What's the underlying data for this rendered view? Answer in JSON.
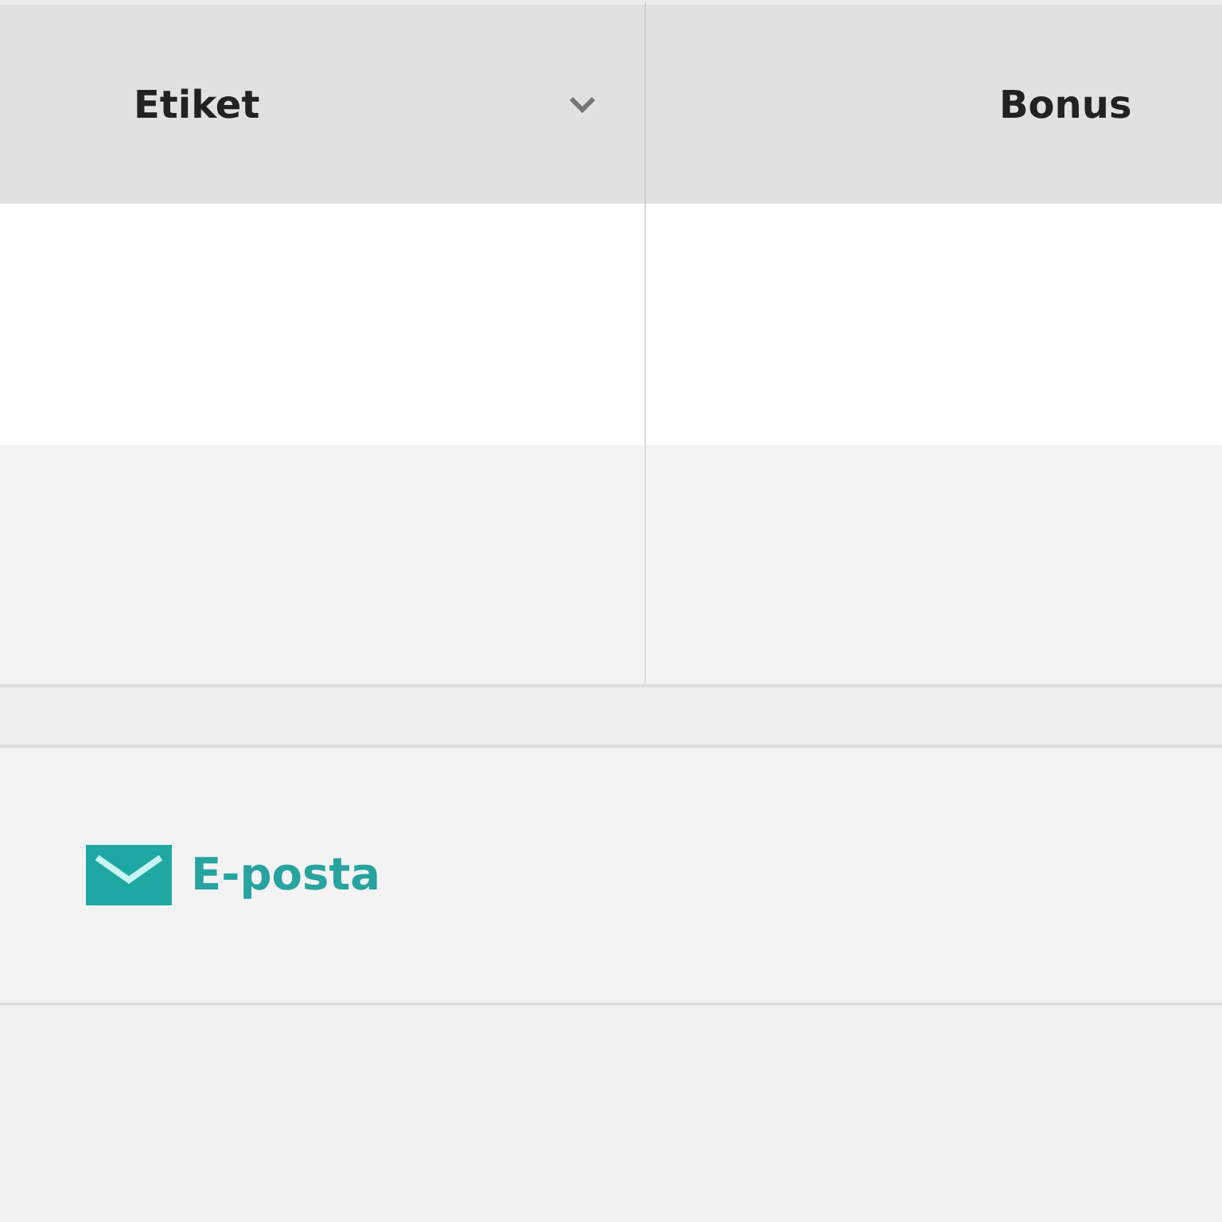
{
  "table": {
    "columns": [
      {
        "label": "Etiket",
        "kind": "dropdown"
      },
      {
        "label": "Bonus",
        "kind": "plain"
      }
    ]
  },
  "share": {
    "link": "E-posta"
  }
}
